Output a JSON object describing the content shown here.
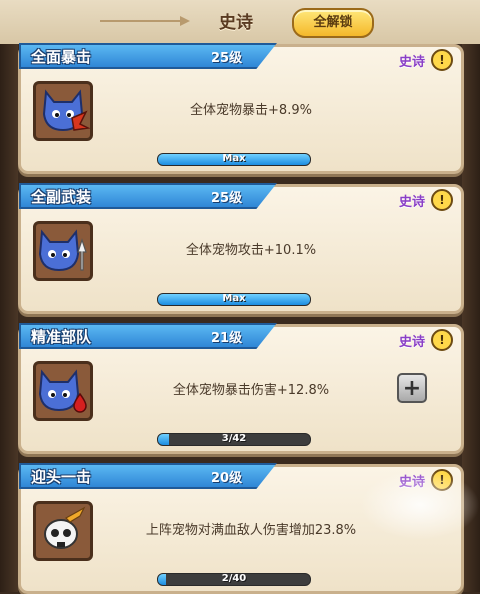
{
  "header": {
    "title": "史诗",
    "unlock_all_label": "全解锁"
  },
  "cards": [
    {
      "name": "全面暴击",
      "level": "25级",
      "rarity": "史诗",
      "info": "!",
      "description": "全体宠物暴击+8.9%",
      "progress_text": "Max",
      "progress": 1.0,
      "icon": "blue-cat-claw-icon"
    },
    {
      "name": "全副武装",
      "level": "25级",
      "rarity": "史诗",
      "info": "!",
      "description": "全体宠物攻击+10.1%",
      "progress_text": "Max",
      "progress": 1.0,
      "icon": "blue-cat-sword-icon"
    },
    {
      "name": "精准部队",
      "level": "21级",
      "rarity": "史诗",
      "info": "!",
      "description": "全体宠物暴击伤害+12.8%",
      "progress_text": "3/42",
      "progress": 0.071,
      "icon": "blue-cat-blood-drop-icon",
      "upgrade_label": "+"
    },
    {
      "name": "迎头一击",
      "level": "20级",
      "rarity": "史诗",
      "info": "!",
      "description": "上阵宠物对满血敌人伤害增加23.8%",
      "progress_text": "2/40",
      "progress": 0.05,
      "icon": "skull-blade-icon"
    }
  ],
  "colors": {
    "ribbon": "#2f86d6",
    "rarity": "#8a3fc7",
    "progress": "#1d8de0",
    "card": "#fbf4e6"
  }
}
